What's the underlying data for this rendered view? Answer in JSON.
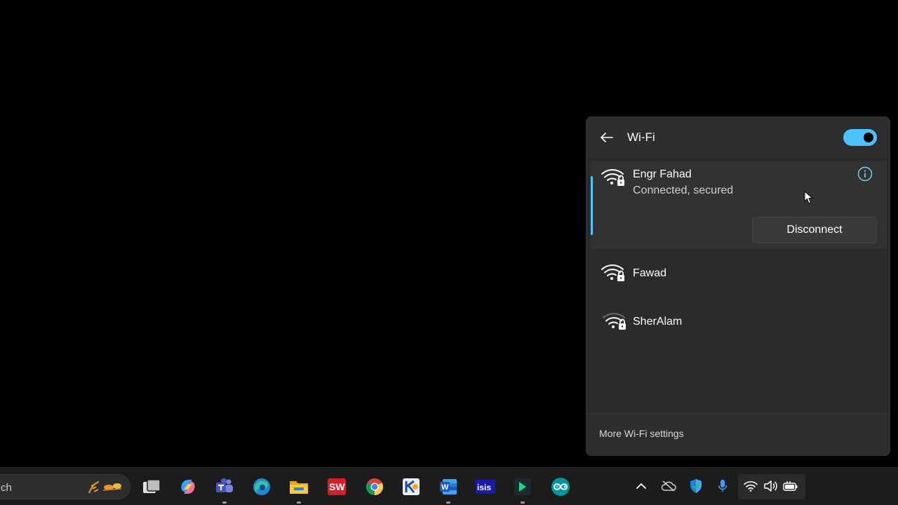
{
  "wifi_panel": {
    "title": "Wi-Fi",
    "toggle_on": true,
    "accent_color": "#4cc2ff",
    "connected_network": {
      "name": "Engr Fahad",
      "status": "Connected, secured",
      "action_label": "Disconnect",
      "icon": "wifi-secured-icon"
    },
    "networks": [
      {
        "name": "Fawad",
        "icon": "wifi-secured-icon"
      },
      {
        "name": "SherAlam",
        "icon": "wifi-secured-icon"
      }
    ],
    "footer_link": "More Wi-Fi settings"
  },
  "taskbar": {
    "search_text": "ch",
    "apps": [
      {
        "name": "task-view"
      },
      {
        "name": "copilot"
      },
      {
        "name": "teams"
      },
      {
        "name": "edge"
      },
      {
        "name": "file-explorer"
      },
      {
        "name": "solidworks",
        "label": "SW"
      },
      {
        "name": "chrome"
      },
      {
        "name": "app-blue-k"
      },
      {
        "name": "word",
        "label": "W"
      },
      {
        "name": "isis",
        "label": "isis"
      },
      {
        "name": "pycharm"
      },
      {
        "name": "arduino"
      }
    ],
    "tray": [
      {
        "name": "chevron-up-icon"
      },
      {
        "name": "cloud-off-icon"
      },
      {
        "name": "security-shield-icon"
      },
      {
        "name": "microphone-icon"
      },
      {
        "name": "wifi-icon"
      },
      {
        "name": "volume-icon"
      },
      {
        "name": "battery-plug-icon"
      }
    ]
  }
}
